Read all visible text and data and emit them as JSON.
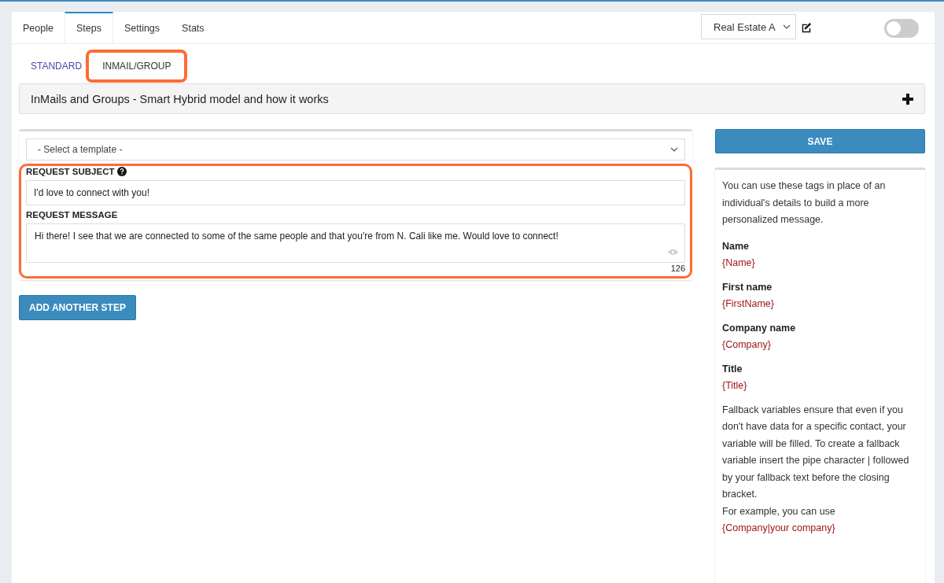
{
  "tabs": [
    {
      "label": "People",
      "selected": false
    },
    {
      "label": "Steps",
      "selected": true
    },
    {
      "label": "Settings",
      "selected": false
    },
    {
      "label": "Stats",
      "selected": false
    }
  ],
  "campaign_select": {
    "value": "Real Estate A"
  },
  "toggle": {
    "on": false
  },
  "subtabs": [
    {
      "label": "STANDARD",
      "selected": false,
      "highlighted": false
    },
    {
      "label": "INMAIL/GROUP",
      "selected": true,
      "highlighted": true
    }
  ],
  "accordion": {
    "title": "InMails and Groups - Smart Hybrid model and how it works"
  },
  "step": {
    "template_select": {
      "value": "- Select a template -"
    },
    "highlighted": true,
    "subject": {
      "label": "REQUEST SUBJECT",
      "value": "I'd love to connect with you!"
    },
    "message": {
      "label": "REQUEST MESSAGE",
      "value": "Hi there! I see that we are connected to some of the same people and that you're from N. Cali like me. Would love to connect!",
      "count": "126"
    }
  },
  "add_step_button": "ADD ANOTHER STEP",
  "save_button": "SAVE",
  "help": {
    "intro": "You can use these tags in place of an individual's details to build a more personalized message.",
    "tags": [
      {
        "name": "Name",
        "tag": "{Name}"
      },
      {
        "name": "First name",
        "tag": "{FirstName}"
      },
      {
        "name": "Company name",
        "tag": "{Company}"
      },
      {
        "name": "Title",
        "tag": "{Title}"
      }
    ],
    "fallback": "Fallback variables ensure that even if you don't have data for a specific contact, your variable will be filled. To create a fallback variable insert the pipe character | followed by your fallback text before the closing bracket.",
    "example": "For example, you can use",
    "example_tag": "{Company|your company}"
  }
}
